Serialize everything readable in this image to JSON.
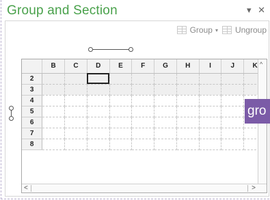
{
  "title": "Group and Section",
  "title_controls": {
    "menu": "▾",
    "close": "✕"
  },
  "toolbar": {
    "group_label": "Group",
    "group_caret": "▾",
    "ungroup_label": "Ungroup"
  },
  "sheet": {
    "columns": [
      "B",
      "C",
      "D",
      "E",
      "F",
      "G",
      "H",
      "I",
      "J",
      "K"
    ],
    "rows": [
      "2",
      "3",
      "4",
      "5",
      "6",
      "7",
      "8"
    ],
    "selected_rows": [
      "2",
      "3"
    ],
    "active_cell": "D2"
  },
  "tooltip": "gro",
  "scroll": {
    "up": "^",
    "left": "<",
    "right": ">"
  },
  "colors": {
    "title": "#49a14b",
    "tooltip_bg": "#7b5ba7"
  }
}
